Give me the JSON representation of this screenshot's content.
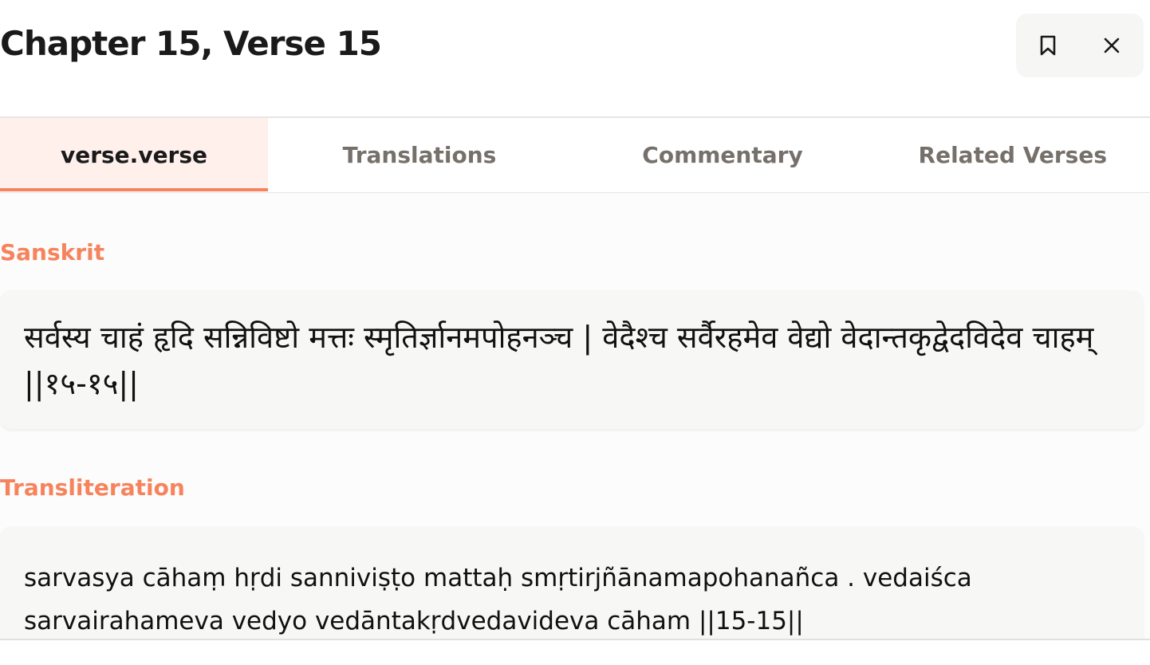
{
  "header": {
    "title": "Chapter 15, Verse 15",
    "actions": [
      {
        "icon": "bookmark-icon"
      },
      {
        "icon": "close-icon"
      }
    ]
  },
  "tabs": [
    {
      "label": "verse.verse",
      "active": true
    },
    {
      "label": "Translations",
      "active": false
    },
    {
      "label": "Commentary",
      "active": false
    },
    {
      "label": "Related Verses",
      "active": false
    }
  ],
  "sections": {
    "sanskrit": {
      "label": "Sanskrit",
      "text": "सर्वस्य चाहं हृदि सन्निविष्टो मत्तः स्मृतिर्ज्ञानमपोहनञ्च | वेदैश्च सर्वैरहमेव वेद्यो वेदान्तकृद्वेदविदेव चाहम् ||१५-१५||"
    },
    "transliteration": {
      "label": "Transliteration",
      "text": "sarvasya cāhaṃ hṛdi sanniviṣṭo mattaḥ smṛtirjñānamapohanañca . vedaiśca sarvairahameva vedyo vedāntakṛdvedavideva cāham ||15-15||"
    }
  },
  "colors": {
    "accent": "#f6835c",
    "active_tab_bg": "#fff0ec",
    "muted_tab_text": "#76706b",
    "card_bg": "#f7f7f6"
  }
}
